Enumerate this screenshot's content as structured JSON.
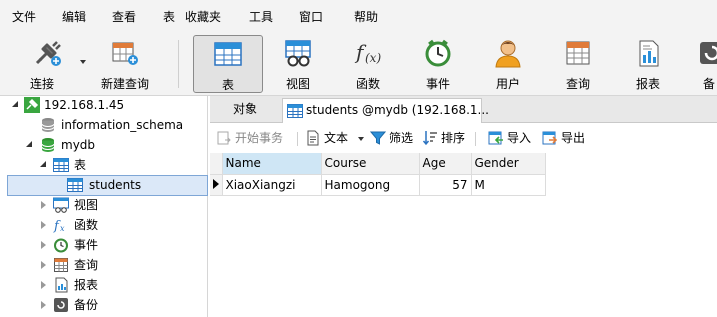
{
  "menu": [
    "文件",
    "编辑",
    "查看",
    "表",
    "收藏夹",
    "工具",
    "窗口",
    "帮助"
  ],
  "toolbar": {
    "connect": "连接",
    "new_query": "新建查询",
    "table": "表",
    "view": "视图",
    "function": "函数",
    "event": "事件",
    "user": "用户",
    "query": "查询",
    "report": "报表",
    "backup": "备"
  },
  "tree": {
    "connection": "192.168.1.45",
    "db_info": "information_schema",
    "db_mydb": "mydb",
    "tables": "表",
    "students": "students",
    "views": "视图",
    "functions": "函数",
    "events": "事件",
    "queries": "查询",
    "reports": "报表",
    "backups": "备份"
  },
  "tabs": {
    "objects": "对象",
    "students_tab": "students @mydb (192.168.1..."
  },
  "subtoolbar": {
    "begin_tx": "开始事务",
    "text": "文本",
    "filter": "筛选",
    "sort": "排序",
    "import": "导入",
    "export": "导出"
  },
  "grid": {
    "columns": [
      "Name",
      "Course",
      "Age",
      "Gender"
    ],
    "rows": [
      [
        "XiaoXiangzi",
        "Hamogong",
        "57",
        "M"
      ]
    ]
  },
  "colors": {
    "accent": "#2b8fd8",
    "db_green": "#3aa640",
    "selection": "#dbe8f8"
  }
}
